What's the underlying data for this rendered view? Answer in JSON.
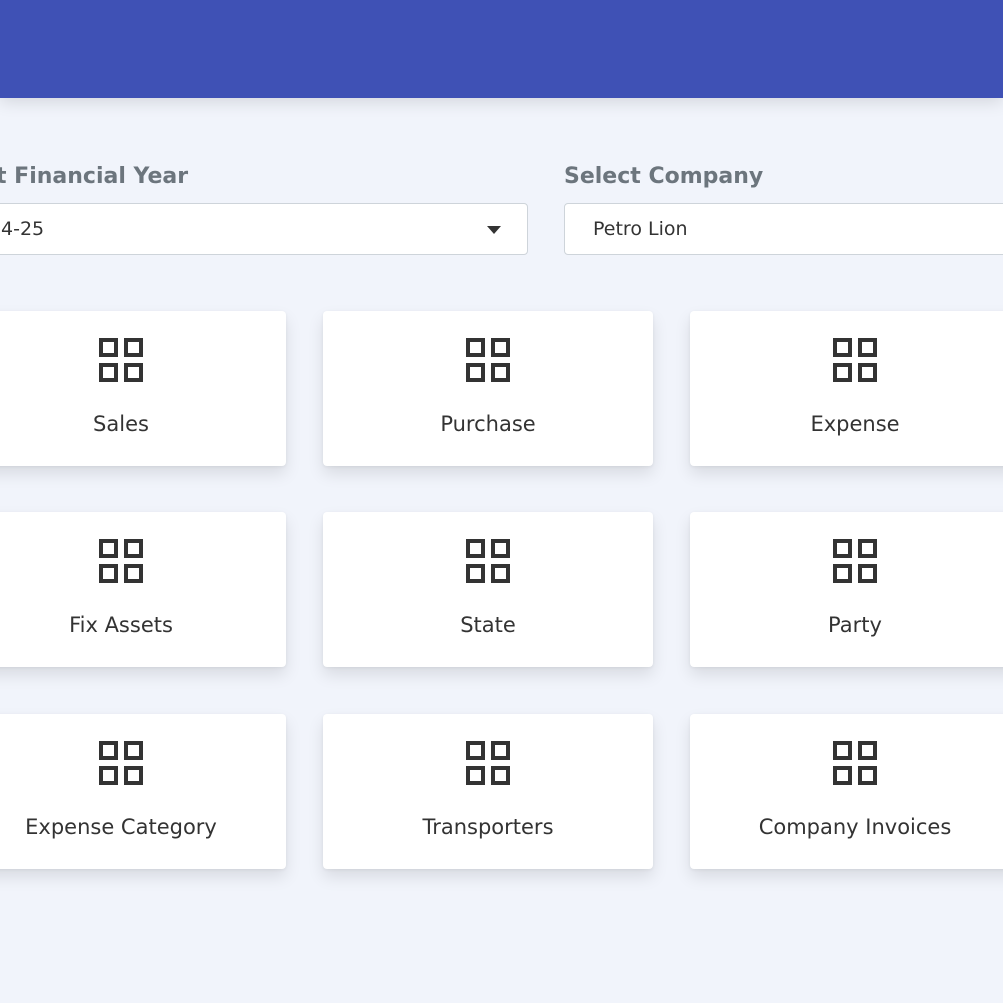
{
  "header": {},
  "filters": {
    "financial_year": {
      "label": "t Financial Year",
      "value": "4-25"
    },
    "company": {
      "label": "Select Company",
      "value": "Petro Lion"
    }
  },
  "menu": {
    "items": [
      {
        "label": "Sales",
        "icon": "grid-icon"
      },
      {
        "label": "Purchase",
        "icon": "grid-icon"
      },
      {
        "label": "Expense",
        "icon": "grid-icon"
      },
      {
        "label": "Fix Assets",
        "icon": "grid-icon"
      },
      {
        "label": "State",
        "icon": "grid-icon"
      },
      {
        "label": "Party",
        "icon": "grid-icon"
      },
      {
        "label": "Expense Category",
        "icon": "grid-icon"
      },
      {
        "label": "Transporters",
        "icon": "grid-icon"
      },
      {
        "label": "Company Invoices",
        "icon": "grid-icon"
      }
    ]
  },
  "colors": {
    "header": "#3f51b5",
    "background": "#f1f4fb",
    "icon": "#333333"
  }
}
